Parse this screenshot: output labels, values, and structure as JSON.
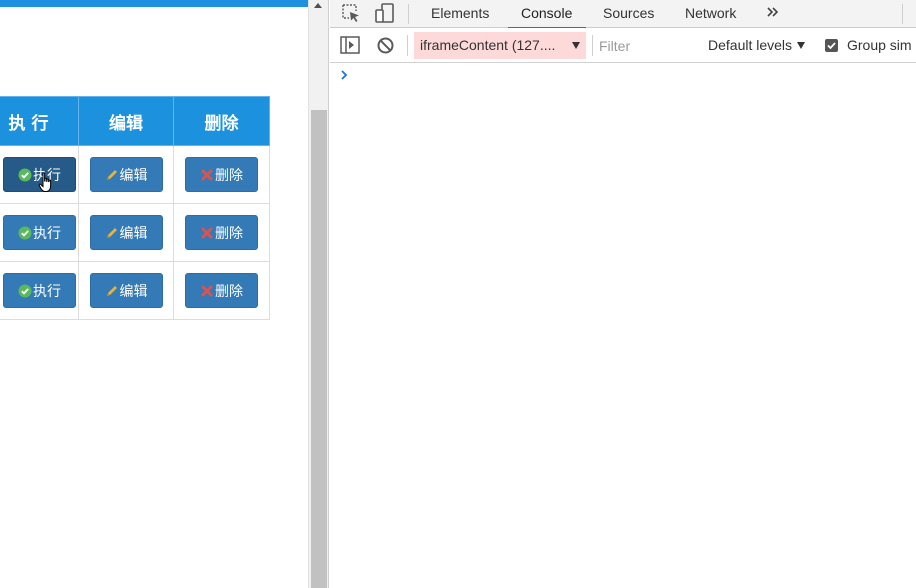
{
  "table": {
    "headers": [
      "执 行",
      "编辑",
      "删除"
    ],
    "rows": [
      {
        "run": "执行",
        "edit": "编辑",
        "delete": "删除"
      },
      {
        "run": "执行",
        "edit": "编辑",
        "delete": "删除"
      },
      {
        "run": "执行",
        "edit": "编辑",
        "delete": "删除"
      }
    ]
  },
  "devtools": {
    "tabs": [
      "Elements",
      "Console",
      "Sources",
      "Network"
    ],
    "selected_tab": "Console",
    "context": "iframeContent (127....",
    "filter_placeholder": "Filter",
    "levels": "Default levels",
    "group_similar": "Group sim",
    "accent": "#1a73e8",
    "context_bg": "#fdd9d9"
  },
  "colors": {
    "header_blue": "#1c91de",
    "button_blue": "#337ab7",
    "check_green": "#5cb85c",
    "pencil_yellow": "#e8b33c",
    "x_red": "#d9534f"
  }
}
